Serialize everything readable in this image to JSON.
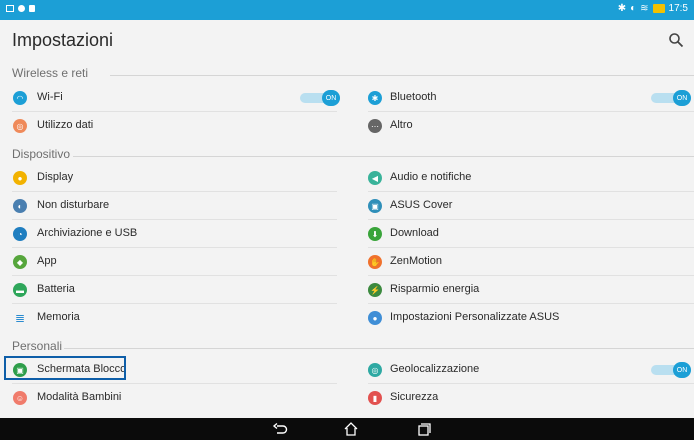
{
  "status": {
    "time": "17:5",
    "bluetooth_icon": "bluetooth-icon",
    "wifi_icon": "wifi-icon",
    "battery_icon": "battery-icon",
    "colors": {
      "statusbar": "#1c9fd6"
    }
  },
  "app": {
    "title": "Impostazioni",
    "search_icon": "search-icon"
  },
  "sections": {
    "wireless": "Wireless e reti",
    "device": "Dispositivo",
    "personal": "Personali"
  },
  "items": {
    "wifi": "Wi-Fi",
    "bluetooth": "Bluetooth",
    "data_usage": "Utilizzo dati",
    "more": "Altro",
    "display": "Display",
    "audio": "Audio e notifiche",
    "dnd": "Non disturbare",
    "asus_cover": "ASUS Cover",
    "storage": "Archiviazione e USB",
    "download": "Download",
    "app": "App",
    "zenmotion": "ZenMotion",
    "battery": "Batteria",
    "power_saver": "Risparmio energia",
    "memory": "Memoria",
    "asus_custom": "Impostazioni Personalizzate ASUS",
    "lock_screen": "Schermata Blocco",
    "location": "Geolocalizzazione",
    "kids_mode": "Modalità Bambini",
    "security": "Sicurezza"
  },
  "toggles": {
    "wifi": "ON",
    "bluetooth": "ON",
    "location": "ON"
  }
}
